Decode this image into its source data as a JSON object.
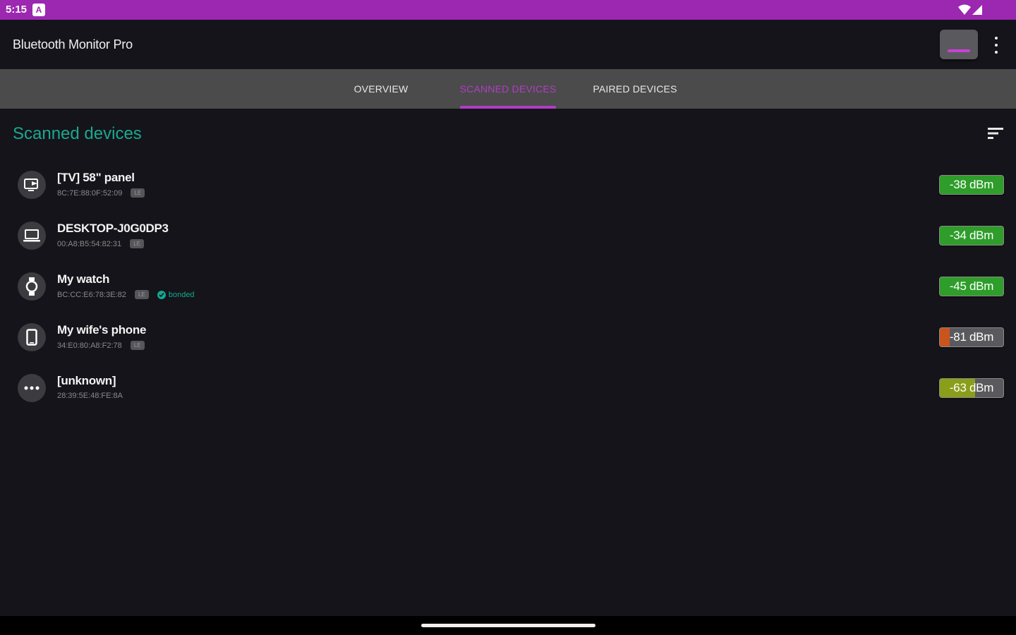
{
  "status_bar": {
    "time": "5:15",
    "notification_icon": "app-notification-icon",
    "wifi_icon": "wifi-icon",
    "signal_icon": "cell-signal-icon"
  },
  "app_bar": {
    "title": "Bluetooth Monitor Pro",
    "action_icon": "scan-toggle-icon",
    "overflow_icon": "more-vertical-icon"
  },
  "tabs": [
    {
      "label": "OVERVIEW",
      "active": false
    },
    {
      "label": "SCANNED DEVICES",
      "active": true
    },
    {
      "label": "PAIRED DEVICES",
      "active": false
    }
  ],
  "section": {
    "title": "Scanned devices",
    "sort_icon": "sort-icon"
  },
  "devices": [
    {
      "name": "[TV] 58\" panel",
      "mac": "8C:7E:88:0F:52:09",
      "type_chip": "LE",
      "bonded": "",
      "rssi": "-38 dBm",
      "signal_fraction": 1.0,
      "signal_color": "#2e9d2a",
      "icon": "tv-cast-icon"
    },
    {
      "name": "DESKTOP-J0G0DP3",
      "mac": "00:A8:B5:54:82:31",
      "type_chip": "LE",
      "bonded": "",
      "rssi": "-34 dBm",
      "signal_fraction": 1.0,
      "signal_color": "#2e9d2a",
      "icon": "laptop-icon"
    },
    {
      "name": "My watch",
      "mac": "BC:CC:E6:78:3E:82",
      "type_chip": "LE",
      "bonded": "bonded",
      "rssi": "-45 dBm",
      "signal_fraction": 1.0,
      "signal_color": "#2e9d2a",
      "icon": "watch-icon"
    },
    {
      "name": "My wife's phone",
      "mac": "34:E0:80:A8:F2:78",
      "type_chip": "LE",
      "bonded": "",
      "rssi": "-81 dBm",
      "signal_fraction": 0.15,
      "signal_color": "#c9541c",
      "icon": "phone-icon"
    },
    {
      "name": "[unknown]",
      "mac": "28:39:5E:48:FE:8A",
      "type_chip": "",
      "bonded": "",
      "rssi": "-63 dBm",
      "signal_fraction": 0.55,
      "signal_color": "#8a9e1a",
      "icon": "more-horizontal-icon"
    }
  ],
  "colors": {
    "status_bar": "#9c27b0",
    "accent": "#b23cc6",
    "section_title": "#1aa890",
    "background": "#15141a",
    "tab_bar": "#4b4b4b"
  }
}
